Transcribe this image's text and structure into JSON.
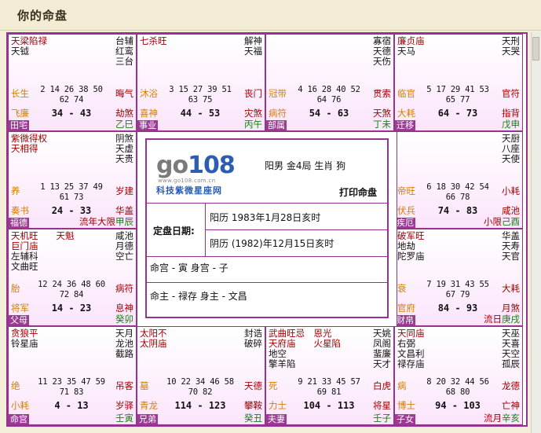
{
  "header": {
    "title": "你的命盘"
  },
  "center": {
    "logo_main": "go108",
    "logo_url": "www.go108.com.cn",
    "logo_cn": "科技紫微星座网",
    "person": "阳男  金4局  生肖 狗",
    "print_label": "打印命盘",
    "date_label": "定盘日期:",
    "solar_date": "阳历 1983年1月28日亥时",
    "lunar_date": "阴历 (1982)年12月15日亥时",
    "ming_gong": "命宫 - 寅   身宫 - 子",
    "ming_zhu": "命主 - 禄存   身主 - 文昌"
  },
  "cells": [
    {
      "id": "si",
      "tl": [
        [
          "天梁陷禄",
          true
        ],
        [
          "天钺",
          false
        ]
      ],
      "tr": [
        "台辅",
        "红鸾",
        "三台"
      ],
      "stage": "长生",
      "age1": "2  14  26  38  50",
      "age2": "62  74",
      "rmid": "晦气",
      "ml": "飞廉",
      "range": "34 - 43",
      "mr": "劫煞",
      "house": "田宅",
      "gz": "乙巳",
      "extra": ""
    },
    {
      "id": "wu",
      "tl": [
        [
          "七杀旺",
          true
        ]
      ],
      "tr": [
        "解神",
        "天福"
      ],
      "stage": "沐浴",
      "age1": "3  15  27  39  51",
      "age2": "63  75",
      "rmid": "丧门",
      "ml": "喜神",
      "range": "44 - 53",
      "mr": "灾煞",
      "house": "事业",
      "gz": "丙午",
      "extra": ""
    },
    {
      "id": "wei",
      "tl": [],
      "tr": [
        "寡宿",
        "天德",
        "天伤"
      ],
      "stage": "冠带",
      "age1": "4  16  28  40  52",
      "age2": "64  76",
      "rmid": "贯索",
      "ml": "病符",
      "range": "54 - 63",
      "mr": "天煞",
      "house": "部属",
      "gz": "丁未",
      "extra": ""
    },
    {
      "id": "shen",
      "tl": [
        [
          "廉贞庙",
          true
        ],
        [
          "天马",
          false
        ]
      ],
      "tr": [
        "天刑",
        "天哭"
      ],
      "stage": "临官",
      "age1": "5  17  29  41  53",
      "age2": "65  77",
      "rmid": "官符",
      "ml": "大耗",
      "range": "64 - 73",
      "mr": "指背",
      "house": "迁移",
      "gz": "戊申",
      "extra": ""
    },
    {
      "id": "chen",
      "tl": [
        [
          "紫微得权",
          true
        ],
        [
          "天相得",
          true
        ]
      ],
      "tr": [
        "阴煞",
        "天虚",
        "天贵"
      ],
      "stage": "养",
      "age1": "1  13  25  37  49",
      "age2": "61  73",
      "rmid": "岁建",
      "ml": "奏书",
      "range": "24 - 33",
      "mr": "华盖",
      "house": "福德",
      "gz": "甲辰",
      "extra": "流年大限"
    },
    {
      "id": "you",
      "tl": [],
      "tr": [
        "天厨",
        "八座",
        "天使"
      ],
      "stage": "帝旺",
      "age1": "6  18  30  42  54",
      "age2": "66  78",
      "rmid": "小耗",
      "ml": "伏兵",
      "range": "74 - 83",
      "mr": "咸池",
      "house": "疾厄",
      "gz": "己酉",
      "extra": "小限"
    },
    {
      "id": "mao",
      "tl": [
        [
          "天机旺　　天魁",
          true
        ],
        [
          "巨门庙",
          true
        ],
        [
          "左辅科",
          false
        ],
        [
          "文曲旺",
          false
        ]
      ],
      "tr": [
        "咸池",
        "月德",
        "空亡"
      ],
      "stage": "胎",
      "age1": "12  24  36  48  60",
      "age2": "72  84",
      "rmid": "病符",
      "ml": "将军",
      "range": "14 - 23",
      "mr": "息神",
      "house": "父母",
      "gz": "癸卯",
      "extra": ""
    },
    {
      "id": "xu",
      "tl": [
        [
          "破军旺",
          true
        ],
        [
          "地劫",
          false
        ],
        [
          "陀罗庙",
          false
        ]
      ],
      "tr": [
        "华盖",
        "天寿",
        "天官"
      ],
      "stage": "衰",
      "age1": "7  19  31  43  55",
      "age2": "67  79",
      "rmid": "大耗",
      "ml": "官府",
      "range": "84 - 93",
      "mr": "月煞",
      "house": "财帛",
      "gz": "庚戌",
      "extra": "流日"
    },
    {
      "id": "yin",
      "tl": [
        [
          "贪狼平",
          true
        ],
        [
          "铃星庙",
          false
        ]
      ],
      "tr": [
        "天月",
        "龙池",
        "截路"
      ],
      "stage": "绝",
      "age1": "11  23  35  47  59",
      "age2": "71  83",
      "rmid": "吊客",
      "ml": "小耗",
      "range": "4 - 13",
      "mr": "岁驿",
      "house": "命宫",
      "gz": "壬寅",
      "extra": ""
    },
    {
      "id": "chou",
      "tl": [
        [
          "太阳不",
          true
        ],
        [
          "太阴庙",
          true
        ]
      ],
      "tr": [
        "封诰",
        "破碎"
      ],
      "stage": "墓",
      "age1": "10  22  34  46  58",
      "age2": "70  82",
      "rmid": "天德",
      "ml": "青龙",
      "range": "114 - 123",
      "mr": "攀鞍",
      "house": "兄弟",
      "gz": "癸丑",
      "extra": ""
    },
    {
      "id": "zi",
      "tl": [
        [
          "武曲旺忌　恩光",
          true
        ],
        [
          "天府庙　　火星陷",
          true
        ],
        [
          "地空",
          false
        ],
        [
          "擎羊陷",
          false
        ]
      ],
      "tr": [
        "天姚",
        "凤阁",
        "蜚廉",
        "天才"
      ],
      "stage": "死",
      "age1": "9  21  33  45  57",
      "age2": "69  81",
      "rmid": "白虎",
      "ml": "力士",
      "range": "104 - 113",
      "mr": "将星",
      "house": "夫妻",
      "gz": "壬子",
      "extra": ""
    },
    {
      "id": "hai",
      "tl": [
        [
          "天同庙",
          true
        ],
        [
          "右弼",
          false
        ],
        [
          "文昌利",
          false
        ],
        [
          "禄存庙",
          false
        ]
      ],
      "tr": [
        "天巫",
        "天喜",
        "天空",
        "孤辰"
      ],
      "stage": "病",
      "age1": "8  20  32  44  56",
      "age2": "68  80",
      "rmid": "龙德",
      "ml": "博士",
      "range": "94 - 103",
      "mr": "亡神",
      "house": "子女",
      "gz": "辛亥",
      "extra": "流月"
    }
  ]
}
